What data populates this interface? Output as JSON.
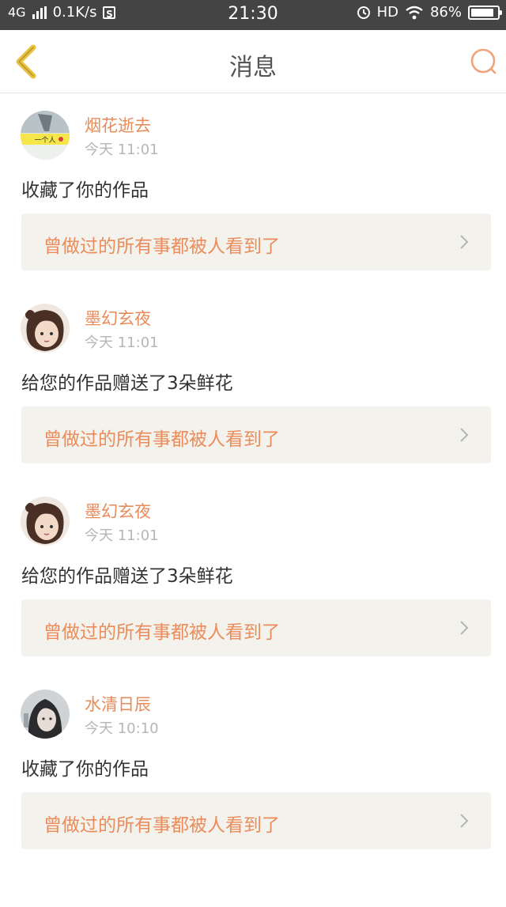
{
  "status_bar": {
    "network": "4G",
    "speed": "0.1K/s",
    "time": "21:30",
    "hd": "HD",
    "battery": "86%",
    "battery_level": 0.86
  },
  "header": {
    "title": "消息"
  },
  "messages": [
    {
      "username": "烟花逝去",
      "time": "今天 11:01",
      "action": "收藏了你的作品",
      "work": "曾做过的所有事都被人看到了",
      "avatar_text": "一个人"
    },
    {
      "username": "墨幻玄夜",
      "time": "今天 11:01",
      "action": "给您的作品赠送了3朵鲜花",
      "work": "曾做过的所有事都被人看到了"
    },
    {
      "username": "墨幻玄夜",
      "time": "今天 11:01",
      "action": "给您的作品赠送了3朵鲜花",
      "work": "曾做过的所有事都被人看到了"
    },
    {
      "username": "水清日辰",
      "time": "今天 10:10",
      "action": "收藏了你的作品",
      "work": "曾做过的所有事都被人看到了"
    }
  ],
  "colors": {
    "accent": "#e88b5a",
    "back_icon": "#e9c13f",
    "card_bg": "#f3f2ec",
    "status_bar": "#444444"
  }
}
